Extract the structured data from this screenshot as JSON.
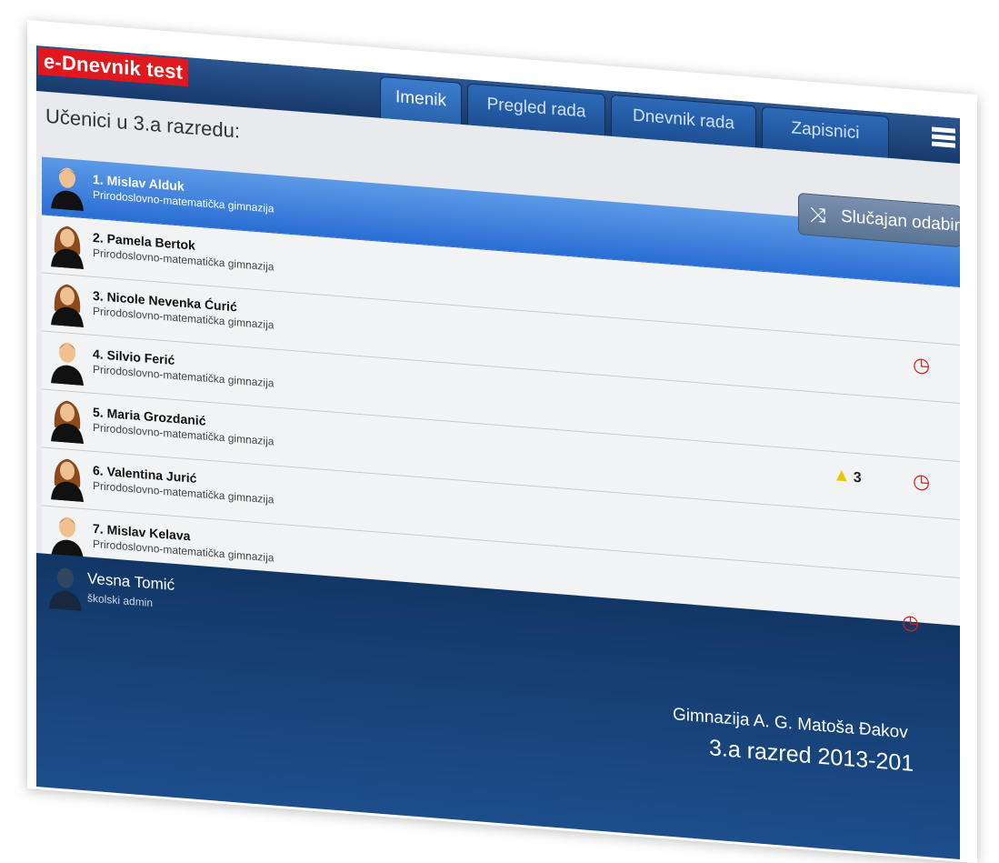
{
  "app": {
    "brand": "e-Dnevnik test"
  },
  "tabs": [
    {
      "label": "Imenik",
      "active": true
    },
    {
      "label": "Pregled rada",
      "active": false
    },
    {
      "label": "Dnevnik rada",
      "active": false
    },
    {
      "label": "Zapisnici",
      "active": false
    }
  ],
  "menu_icon": "hamburger-icon",
  "page": {
    "heading": "Učenici u 3.a razredu:",
    "random_button": {
      "icon": "shuffle-icon",
      "label": "Slučajan odabir"
    }
  },
  "students": [
    {
      "name": "1. Mislav Alduk",
      "school": "Prirodoslovno-matematička gimnazija",
      "selected": true,
      "avatar": "male-avatar",
      "warning_count": null,
      "clock": false
    },
    {
      "name": "2. Pamela Bertok",
      "school": "Prirodoslovno-matematička gimnazija",
      "selected": false,
      "avatar": "female-avatar",
      "warning_count": null,
      "clock": false
    },
    {
      "name": "3. Nicole Nevenka Ćurić",
      "school": "Prirodoslovno-matematička gimnazija",
      "selected": false,
      "avatar": "female-avatar",
      "warning_count": null,
      "clock": true
    },
    {
      "name": "4. Silvio Ferić",
      "school": "Prirodoslovno-matematička gimnazija",
      "selected": false,
      "avatar": "male-avatar",
      "warning_count": null,
      "clock": false
    },
    {
      "name": "5. Maria Grozdanić",
      "school": "Prirodoslovno-matematička gimnazija",
      "selected": false,
      "avatar": "female-avatar",
      "warning_count": "3",
      "clock": true
    },
    {
      "name": "6. Valentina Jurić",
      "school": "Prirodoslovno-matematička gimnazija",
      "selected": false,
      "avatar": "female-avatar",
      "warning_count": null,
      "clock": false
    },
    {
      "name": "7. Mislav Kelava",
      "school": "Prirodoslovno-matematička gimnazija",
      "selected": false,
      "avatar": "male-avatar",
      "warning_count": null,
      "clock": false
    }
  ],
  "footer": {
    "user_name": "Vesna Tomić",
    "user_role": "školski admin",
    "school": "Gimnazija A. G. Matoša Đakov",
    "class_year": "3.a razred 2013-201",
    "clock": true
  },
  "colors": {
    "brand_bg": "#e1191e",
    "topbar": "#1d4a85",
    "selected_row": "#2a6ed4",
    "clock": "#e01e1e",
    "warning": "#f0c400"
  }
}
